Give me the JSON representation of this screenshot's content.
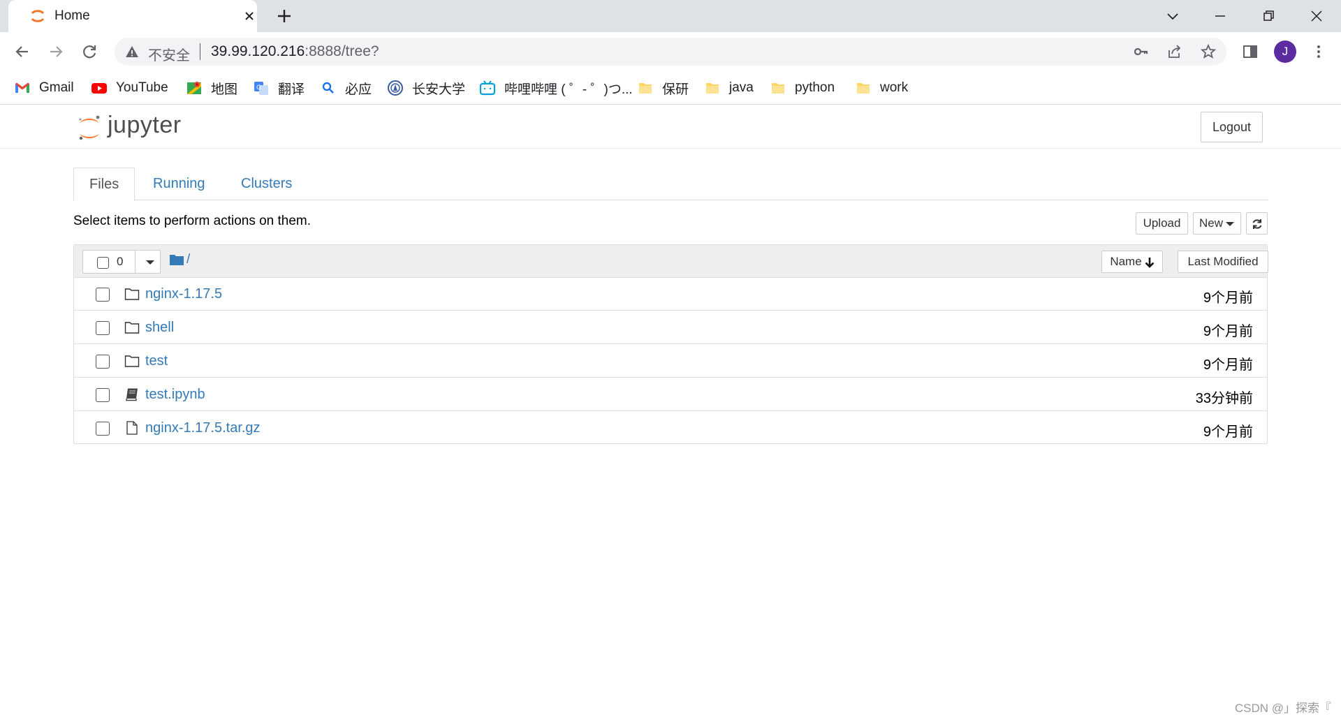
{
  "browser": {
    "tab_title": "Home",
    "url_insecure_label": "不安全",
    "url_host": "39.99.120.216",
    "url_rest": ":8888/tree?",
    "avatar_letter": "J",
    "bookmarks": [
      {
        "label": "Gmail",
        "icon": "gmail-icon"
      },
      {
        "label": "YouTube",
        "icon": "youtube-icon"
      },
      {
        "label": "地图",
        "icon": "maps-icon"
      },
      {
        "label": "翻译",
        "icon": "translate-icon"
      },
      {
        "label": "必应",
        "icon": "search-icon"
      },
      {
        "label": "长安大学",
        "icon": "university-icon"
      },
      {
        "label": "哔哩哔哩 ( ゜- ゜)つ...",
        "icon": "bilibili-icon"
      },
      {
        "label": "保研",
        "icon": "folder-icon"
      },
      {
        "label": "java",
        "icon": "folder-icon"
      },
      {
        "label": "python",
        "icon": "folder-icon"
      },
      {
        "label": "work",
        "icon": "folder-icon"
      }
    ]
  },
  "jupyter": {
    "logo_text": "jupyter",
    "logout_label": "Logout",
    "tabs": [
      {
        "label": "Files",
        "active": true
      },
      {
        "label": "Running",
        "active": false
      },
      {
        "label": "Clusters",
        "active": false
      }
    ],
    "hint_text": "Select items to perform actions on them.",
    "upload_label": "Upload",
    "new_label": "New",
    "selected_count": "0",
    "breadcrumb_root": "/",
    "sort_name_label": "Name",
    "last_modified_label": "Last Modified",
    "files": [
      {
        "name": "nginx-1.17.5",
        "type": "folder",
        "modified": "9个月前"
      },
      {
        "name": "shell",
        "type": "folder",
        "modified": "9个月前"
      },
      {
        "name": "test",
        "type": "folder",
        "modified": "9个月前"
      },
      {
        "name": "test.ipynb",
        "type": "notebook",
        "modified": "33分钟前"
      },
      {
        "name": "nginx-1.17.5.tar.gz",
        "type": "file",
        "modified": "9个月前"
      }
    ]
  },
  "watermark": "CSDN @」探索『",
  "colors": {
    "link": "#337ab7",
    "jupyter_orange": "#f37726",
    "avatar": "#5b2ca0"
  }
}
